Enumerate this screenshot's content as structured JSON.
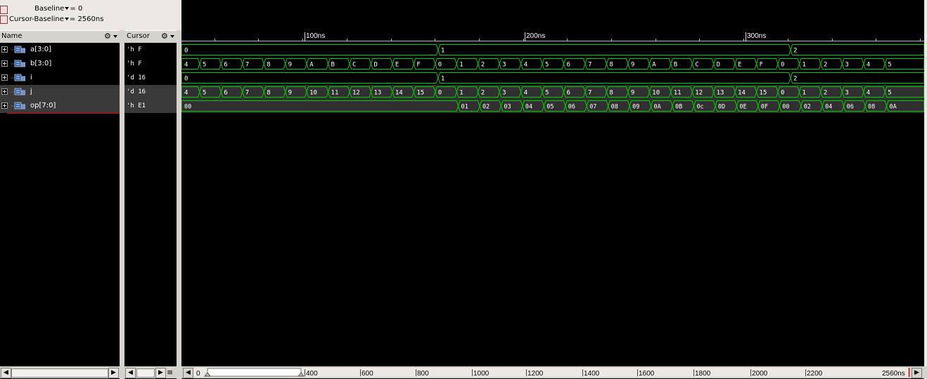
{
  "toolbar": {
    "baseline_label": "Baseline",
    "baseline_value": "= 0",
    "cursor_baseline_label": "Cursor-Baseline",
    "cursor_baseline_value": "= 2560ns"
  },
  "name_panel": {
    "header": "Name",
    "signals": [
      {
        "name": "a[3:0]"
      },
      {
        "name": "b[3:0]"
      },
      {
        "name": "i"
      },
      {
        "name": "j"
      },
      {
        "name": "op[7:0]"
      }
    ]
  },
  "cursor_panel": {
    "header": "Cursor",
    "values": [
      "'h F",
      "'h F",
      "'d 16",
      "'d 16",
      "'h E1"
    ]
  },
  "timeline": {
    "labels": [
      "100ns",
      "200ns",
      "300ns"
    ]
  },
  "waveforms": {
    "color": "#00d000",
    "rows": [
      {
        "signal": "a[3:0]",
        "values": [
          "0",
          "1",
          "2"
        ]
      },
      {
        "signal": "b[3:0]",
        "values": [
          "4",
          "5",
          "6",
          "7",
          "8",
          "9",
          "A",
          "B",
          "C",
          "D",
          "E",
          "F",
          "0",
          "1",
          "2",
          "3",
          "4",
          "5",
          "6",
          "7",
          "8",
          "9",
          "A",
          "B",
          "C",
          "D",
          "E",
          "F",
          "0",
          "1",
          "2",
          "3",
          "4",
          "5"
        ]
      },
      {
        "signal": "i",
        "values": [
          "0",
          "1",
          "2"
        ]
      },
      {
        "signal": "j",
        "values": [
          "4",
          "5",
          "6",
          "7",
          "8",
          "9",
          "10",
          "11",
          "12",
          "13",
          "14",
          "15",
          "0",
          "1",
          "2",
          "3",
          "4",
          "5",
          "6",
          "7",
          "8",
          "9",
          "10",
          "11",
          "12",
          "13",
          "14",
          "15",
          "0",
          "1",
          "2",
          "3",
          "4",
          "5"
        ]
      },
      {
        "signal": "op[7:0]",
        "values": [
          "00",
          "01",
          "02",
          "03",
          "04",
          "05",
          "06",
          "07",
          "08",
          "09",
          "0A",
          "0B",
          "0c",
          "0D",
          "0E",
          "0F",
          "00",
          "02",
          "04",
          "06",
          "08",
          "0A"
        ]
      }
    ]
  },
  "bottom_scroll": {
    "ticks": [
      "0",
      "400",
      "600",
      "800",
      "1000",
      "1200",
      "1400",
      "1600",
      "1800",
      "2000",
      "2200",
      "2560ns"
    ]
  }
}
